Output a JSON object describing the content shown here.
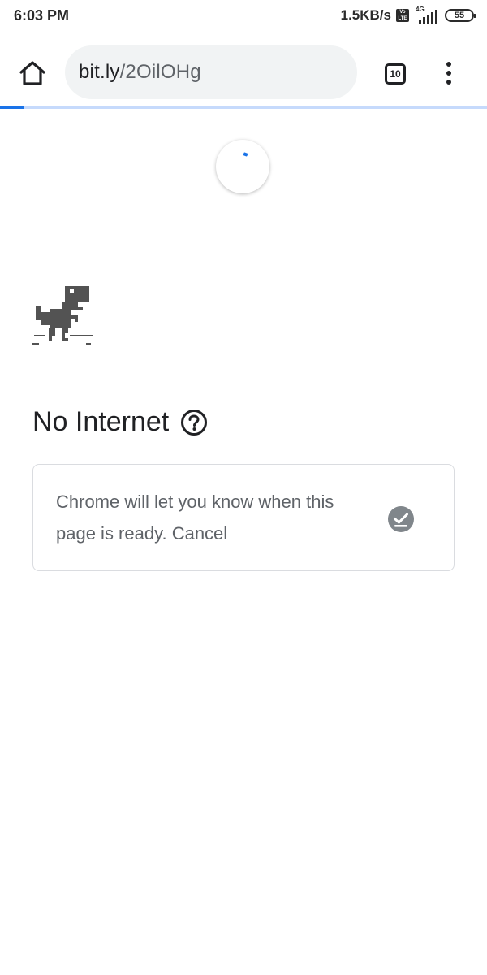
{
  "status_bar": {
    "time": "6:03 PM",
    "net_speed": "1.5KB/s",
    "volte": "Vo LTE",
    "network_type": "4G",
    "battery_level": "55"
  },
  "toolbar": {
    "url_host": "bit.ly",
    "url_path": "/2OilOHg",
    "tab_count": "10"
  },
  "page_load": {
    "progress": 0.05
  },
  "error_page": {
    "title": "No Internet",
    "notify_text": "Chrome will let you know when this page is ready.",
    "cancel_label": "Cancel"
  },
  "colors": {
    "accent": "#1a73e8",
    "progress_track": "#c6dafc",
    "text_primary": "#202124",
    "text_secondary": "#5f6368",
    "omnibox_bg": "#f1f3f4"
  }
}
